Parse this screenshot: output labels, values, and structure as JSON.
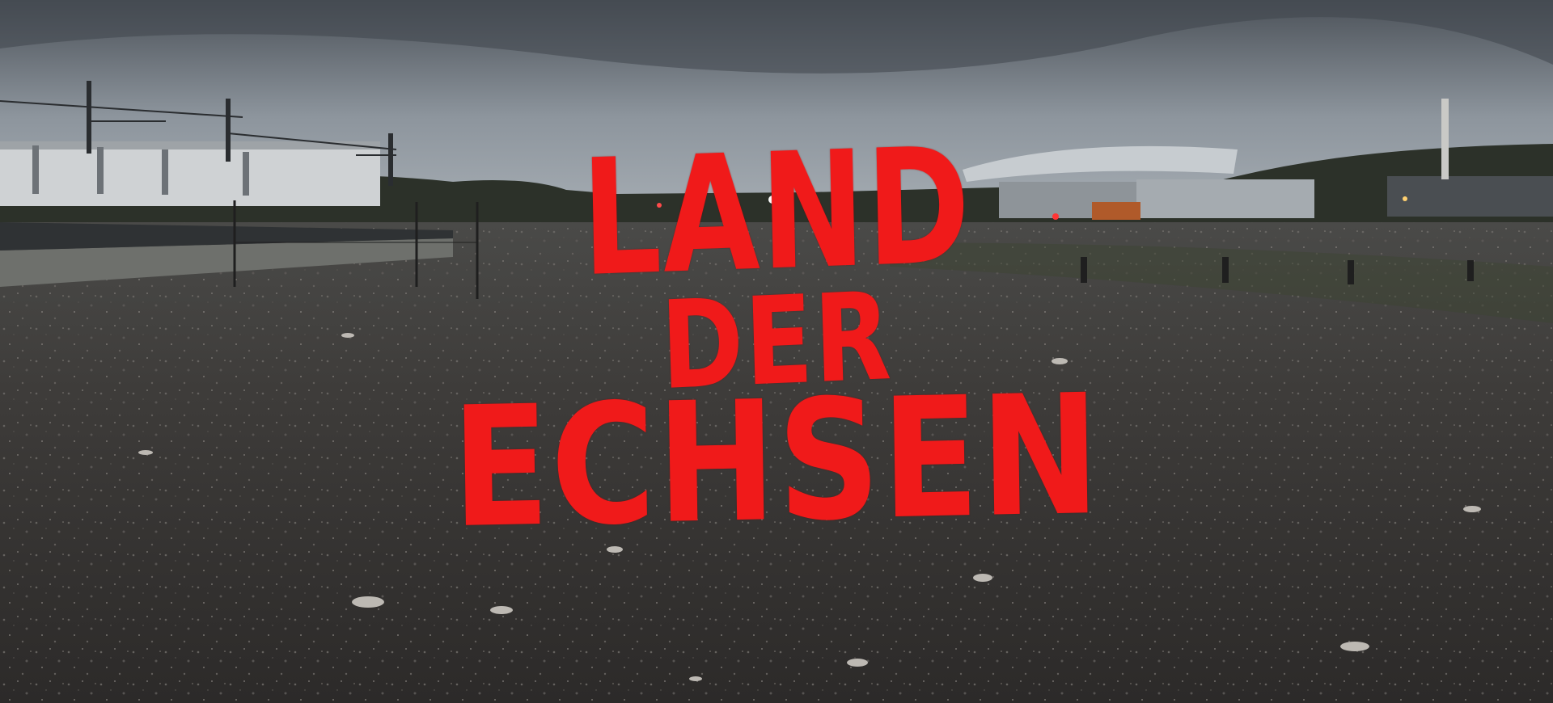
{
  "title": {
    "line1": "LAND",
    "line2": "DER",
    "line3": "ECHSEN"
  },
  "colors": {
    "title_red": "#f01a1a",
    "sky": "#8c949c",
    "ground": "#3a3836"
  }
}
